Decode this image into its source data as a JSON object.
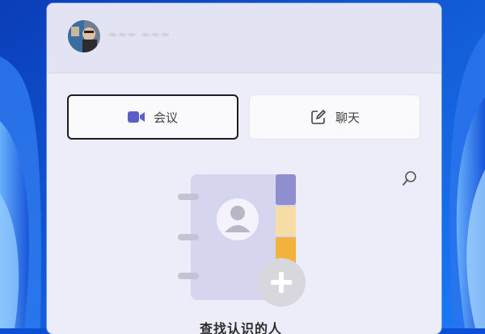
{
  "user": {
    "name_blurred": "~~~ ~~~"
  },
  "actions": {
    "meeting_label": "会议",
    "chat_label": "聊天"
  },
  "empty_state": {
    "hint_text": "查找认识的人"
  },
  "colors": {
    "wallpaper": "#0a4fd6",
    "panel_bg": "#ecedf8",
    "accent_purple": "#5b5fc7",
    "tab_gold": "#f1b33c"
  },
  "icons": [
    "video-camera-icon",
    "compose-icon",
    "search-icon",
    "contacts-book-icon",
    "add-icon"
  ]
}
